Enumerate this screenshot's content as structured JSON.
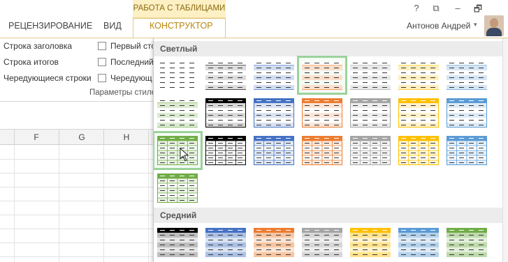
{
  "ribbon": {
    "context_tab_group": "РАБОТА С ТАБЛИЦАМИ",
    "tabs": [
      {
        "label": "РЕЦЕНЗИРОВАНИЕ"
      },
      {
        "label": "ВИД"
      },
      {
        "label": "КОНСТРУКТОР"
      }
    ],
    "active_tab": "КОНСТРУКТОР",
    "window_buttons": [
      "?",
      "⧉",
      "–",
      "🗗"
    ],
    "user_name": "Антонов Андрей",
    "user_caret": "▾"
  },
  "table_style_options": {
    "left_column": [
      "Строка заголовка",
      "Строка итогов",
      "Чередующиеся строки"
    ],
    "right_column": [
      "Первый сто",
      "Последний",
      "Чередующ"
    ],
    "group_label": "Параметры стиле"
  },
  "sheet": {
    "column_headers": [
      "F",
      "G",
      "H"
    ]
  },
  "gallery": {
    "sections": [
      {
        "title": "Светлый"
      },
      {
        "title": "Средний"
      }
    ],
    "accent_colors": {
      "none": "#000000",
      "blue": "#4472c4",
      "orange": "#ed7d31",
      "gray": "#a5a5a5",
      "gold": "#ffc000",
      "blue2": "#5b9bd5",
      "green": "#70ad47"
    },
    "light_row1": [
      "none",
      "none",
      "blue",
      "orange",
      "gray",
      "gold",
      "blue2"
    ],
    "light_row2": [
      "green",
      "none",
      "blue",
      "orange",
      "gray",
      "gold",
      "blue2"
    ],
    "light_row3": [
      "green",
      "none",
      "blue",
      "orange",
      "gray",
      "gold",
      "blue2"
    ],
    "light_row4": [
      "green"
    ],
    "medium_row1": [
      "none",
      "blue",
      "orange",
      "gray",
      "gold",
      "blue2",
      "green"
    ],
    "selected_style": "light-orange-1",
    "hovered_style": "light-green-3"
  }
}
